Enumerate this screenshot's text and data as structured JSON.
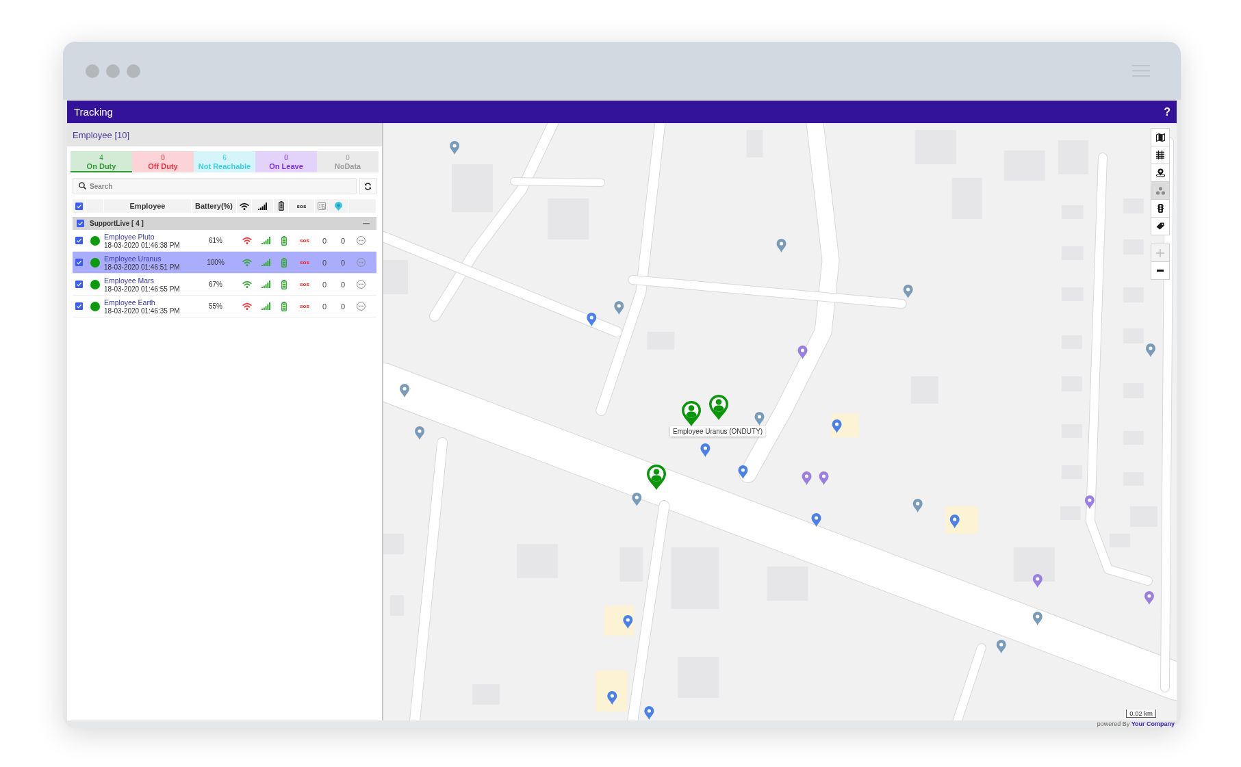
{
  "app": {
    "title": "Tracking",
    "help": "?"
  },
  "panel": {
    "title": "Employee [10]",
    "status_tabs": [
      {
        "count": "4",
        "label": "On Duty",
        "color": "#2f9b34",
        "selected": true
      },
      {
        "count": "0",
        "label": "Off Duty",
        "color": "#ef2f3f",
        "selected": false
      },
      {
        "count": "6",
        "label": "Not Reachable",
        "color": "#3ccfe6",
        "selected": false
      },
      {
        "count": "0",
        "label": "On Leave",
        "color": "#7a2ee6",
        "selected": false
      },
      {
        "count": "0",
        "label": "NoData",
        "color": "#9a9a9a",
        "selected": false
      }
    ],
    "search": {
      "placeholder": "Search"
    },
    "table": {
      "checked": true,
      "columns": [
        {
          "kind": "text",
          "label": "Employee"
        },
        {
          "kind": "text",
          "label": "Battery(%)"
        },
        {
          "kind": "wifi"
        },
        {
          "kind": "signal"
        },
        {
          "kind": "battery"
        },
        {
          "kind": "text",
          "label": "sos"
        },
        {
          "kind": "checklist"
        },
        {
          "kind": "pin"
        }
      ],
      "groups": [
        {
          "name": "SupportLive [ 4 ]",
          "checked": true,
          "expanded": true,
          "rows": [
            {
              "name": "Employee Pluto",
              "time": "18-03-2020 01:46:38 PM",
              "checked": true,
              "selected": false,
              "color": "#0b9b0b",
              "battery": "61%",
              "wifi": {
                "color": "#ff2b2b"
              },
              "sos": "sos",
              "cells": [
                "0",
                "0"
              ]
            },
            {
              "name": "Employee Uranus",
              "time": "18-03-2020 01:46:51 PM",
              "checked": true,
              "selected": true,
              "color": "#0b9b0b",
              "battery": "100%",
              "wifi": {
                "color": "#2ea82e"
              },
              "sos": "sos",
              "cells": [
                "0",
                "0"
              ]
            },
            {
              "name": "Employee Mars",
              "time": "18-03-2020 01:46:55 PM",
              "checked": true,
              "selected": false,
              "color": "#0b9b0b",
              "battery": "67%",
              "wifi": {
                "color": "#2ea82e"
              },
              "sos": "sos",
              "cells": [
                "0",
                "0"
              ]
            },
            {
              "name": "Employee Earth",
              "time": "18-03-2020 01:46:35 PM",
              "checked": true,
              "selected": false,
              "color": "#0b9b0b",
              "battery": "55%",
              "wifi": {
                "color": "#ff2b2b"
              },
              "sos": "sos",
              "cells": [
                "0",
                "0"
              ]
            }
          ]
        }
      ]
    }
  },
  "map": {
    "tools": [
      {
        "kind": "map",
        "selected": false
      },
      {
        "kind": "rail",
        "selected": false
      },
      {
        "kind": "person",
        "selected": false
      },
      {
        "kind": "cluster",
        "selected": true
      },
      {
        "kind": "traffic",
        "selected": false
      },
      {
        "kind": "tag",
        "selected": false
      }
    ],
    "zoom": [
      {
        "kind": "in",
        "disabled": true
      },
      {
        "kind": "out",
        "disabled": false
      }
    ],
    "tooltip": "Employee Uranus (ONDUTY)",
    "scale": "0.02 km"
  },
  "footer": {
    "powered_by": "powered By **Your Company**"
  }
}
